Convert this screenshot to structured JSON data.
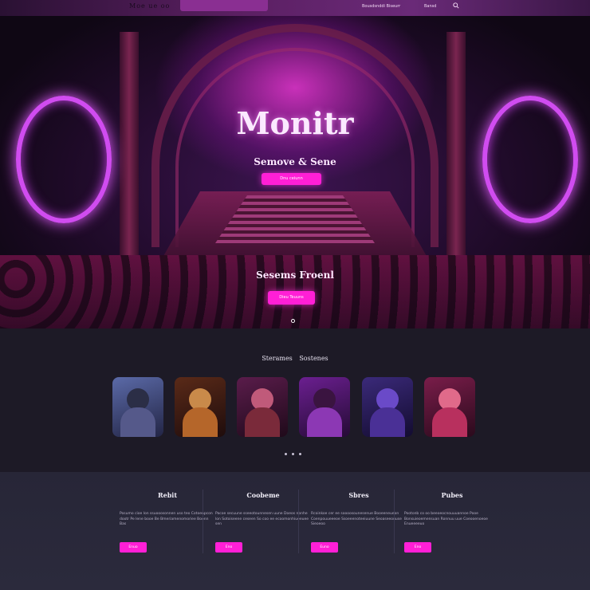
{
  "nav": {
    "logo": "Moe ue oo",
    "links": [
      "Bousdsnddi Biseurr",
      "Bansd"
    ],
    "search_icon": "search-icon"
  },
  "hero": {
    "title": "Monitr",
    "subtitle": "Semove & Sene",
    "cta_label": "Dnu ceiunn",
    "subtitle2": "Sesems Froenl",
    "cta2_label": "Dieu Teuuns",
    "slide_indicator": "slide-dot"
  },
  "featured": {
    "title": "Sterames Sostenes",
    "cards": [
      {
        "name": "character-1",
        "bg": "#3a3f66",
        "accent": "#6b76b7"
      },
      {
        "name": "character-2",
        "bg": "#3a1a16",
        "accent": "#c97a2e"
      },
      {
        "name": "character-3",
        "bg": "#3b1438",
        "accent": "#b0487e"
      },
      {
        "name": "character-4",
        "bg": "#3f1157",
        "accent": "#a13fc6"
      },
      {
        "name": "character-5",
        "bg": "#2a1a54",
        "accent": "#6a47c8"
      },
      {
        "name": "character-6",
        "bg": "#4a1135",
        "accent": "#e0407e"
      }
    ],
    "pagination": 3
  },
  "footer": {
    "columns": [
      {
        "title": "Rebit",
        "text": "Posumo cioe lon ssuooosonnen uso teo Cotoenpcon dootr Pe lene booe Be Bmeriamenomoriee Boonn Bas",
        "button": "Enuo"
      },
      {
        "title": "Coobeme",
        "text": "Pacoe secuune sseeotounnesen uune Doeos nonhe lon Sotoiseene ceseen So coo ee ecoomonhiueeuee sen",
        "button": "Eno"
      },
      {
        "title": "Sbres",
        "text": "Rcoinkoe cer ee soooosounesenue Booeeneueon Coenpouueeeoe Ssoeeenoteeiuune Seoaseeouuse Sieoeoo",
        "button": "Euno"
      },
      {
        "title": "Pubes",
        "text": "Pootonb co oo beeoeocnouuuannoe Pooe Bonsuieoemensuan Ronnuu uue Coeooenoeoe Enueeeeuo",
        "button": "Eno"
      }
    ]
  },
  "colors": {
    "accent": "#ff1fd6",
    "nav_bg": "#5b1f62",
    "section_bg": "#1d1a26",
    "footer_bg": "#2a2939"
  }
}
